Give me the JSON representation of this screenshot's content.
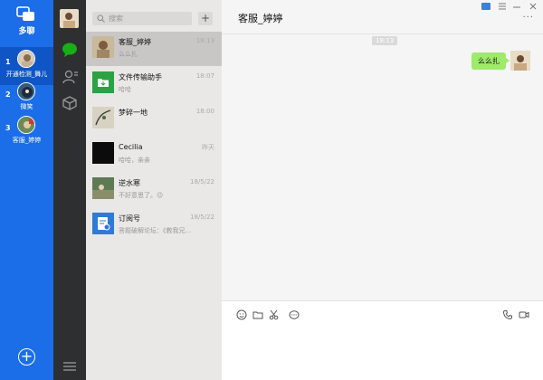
{
  "multi_open": {
    "title": "多聊",
    "accounts": [
      {
        "index": "1",
        "name": "开通检测_舞儿"
      },
      {
        "index": "2",
        "name": "微笑"
      },
      {
        "index": "3",
        "name": "客服_婷婷"
      }
    ],
    "add_label": "+"
  },
  "search": {
    "placeholder": "搜索",
    "add_label": "+"
  },
  "conversations": [
    {
      "name": "客服_婷婷",
      "time": "18:13",
      "message": "么么扎"
    },
    {
      "name": "文件传输助手",
      "time": "18:07",
      "message": "哈哈"
    },
    {
      "name": "梦碎一地",
      "time": "18:00",
      "message": ""
    },
    {
      "name": "Cecilia",
      "time": "昨天",
      "message": "哈哈，亲亲"
    },
    {
      "name": "逆水寒",
      "time": "18/5/22",
      "message": "不好意思了。😉"
    },
    {
      "name": "订阅号",
      "time": "18/5/22",
      "message": "答题破解论坛：《教我兄..."
    }
  ],
  "chat": {
    "title": "客服_婷婷",
    "more": "···",
    "timestamp": "18:13",
    "messages": [
      {
        "from": "me",
        "text": "么么扎"
      }
    ]
  },
  "colors": {
    "multi_bg": "#1b6ee8",
    "nav_bg": "#2d2f31",
    "list_bg": "#e9e8e7",
    "selected_bg": "#c9c7c6",
    "bubble_me": "#9eea6a",
    "chat_bg": "#f5f5f5"
  }
}
